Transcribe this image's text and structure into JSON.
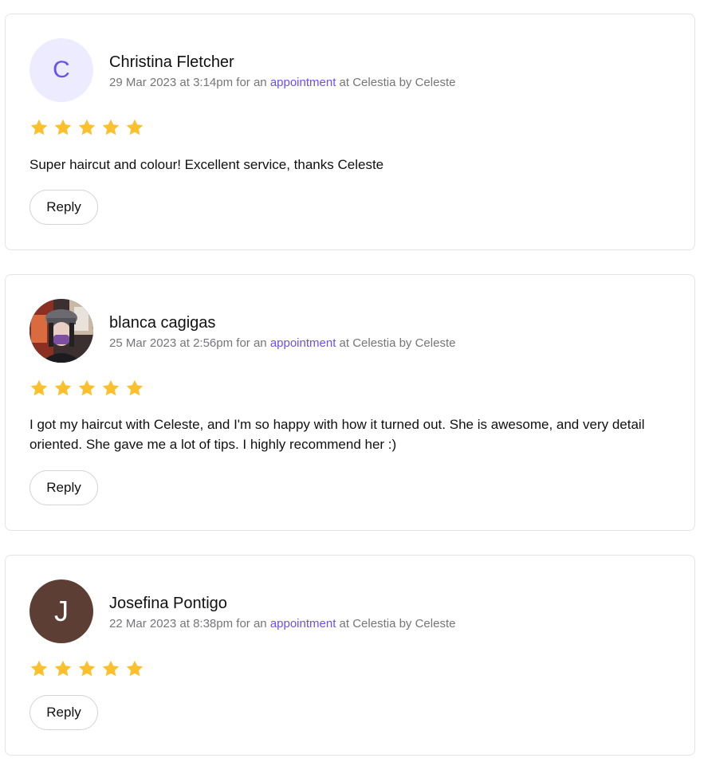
{
  "reviews": [
    {
      "initial": "C",
      "name": "Christina Fletcher",
      "date": "29 Mar 2023 at 3:14pm",
      "for_text": " for an ",
      "link_text": "appointment",
      "at_text": " at Celestia by Celeste",
      "rating": 5,
      "text": "Super haircut and colour! Excellent service, thanks Celeste",
      "reply_label": "Reply"
    },
    {
      "name": "blanca cagigas",
      "date": "25 Mar 2023 at 2:56pm",
      "for_text": " for an ",
      "link_text": "appointment",
      "at_text": " at Celestia by Celeste",
      "rating": 5,
      "text": "I got my haircut with Celeste, and I'm so happy with how it turned out. She is awesome, and very detail oriented. She gave me a lot of tips. I highly recommend her :)",
      "reply_label": "Reply"
    },
    {
      "initial": "J",
      "name": "Josefina Pontigo",
      "date": "22 Mar 2023 at 8:38pm",
      "for_text": " for an ",
      "link_text": "appointment",
      "at_text": " at Celestia by Celeste",
      "rating": 5,
      "reply_label": "Reply"
    }
  ],
  "colors": {
    "star": "#fbc02d",
    "link": "#6950f3",
    "avatar_c_bg": "#ecebff",
    "avatar_j_bg": "#5d3e34"
  },
  "icons": {
    "star": "star-icon"
  }
}
